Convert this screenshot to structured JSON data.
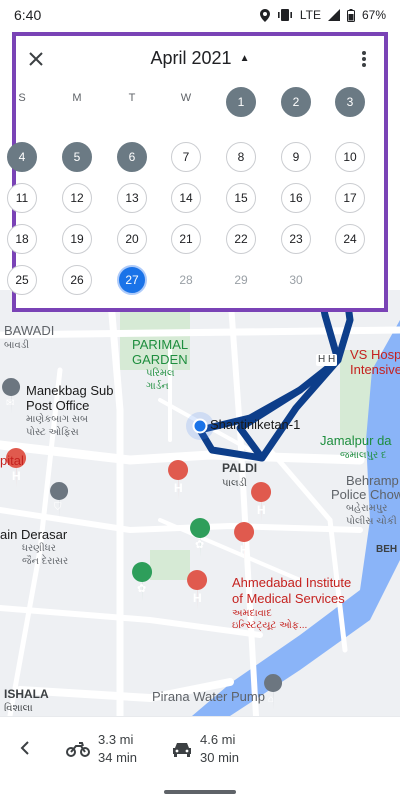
{
  "status_bar": {
    "time": "6:40",
    "network": "LTE",
    "battery": "67%",
    "icons": [
      "location-icon",
      "vibrate-icon",
      "signal-icon",
      "battery-icon"
    ]
  },
  "calendar": {
    "month_title": "April 2021",
    "caret": "▲",
    "close_icon": "close-icon",
    "more_icon": "more-vert-icon",
    "weekdays": [
      "S",
      "M",
      "T",
      "W",
      "T",
      "F",
      "S"
    ],
    "first_weekday_index": 4,
    "days_in_month": 30,
    "selected_day": 27,
    "days_with_history": [
      1,
      2,
      3,
      4,
      5,
      6
    ],
    "colors": {
      "border": "#7a43b6",
      "history": "#6b7a84",
      "selected": "#1a73e8"
    }
  },
  "map": {
    "labels": {
      "bawadi": "BAWADI",
      "bawadi_local": "બાવડી",
      "parimal_1": "PARIMAL",
      "parimal_2": "GARDEN",
      "parimal_local_1": "પરિમલ",
      "parimal_local_2": "ગાર્ડન",
      "vs_hosp_1": "VS Hosp",
      "vs_hosp_2": "Intensive",
      "manekbag_1": "Manekbag Sub",
      "manekbag_2": "Post Office",
      "manekbag_local_1": "માણેકબાગ સબ",
      "manekbag_local_2": "પોસ્ટ ઓફિસ",
      "shantiniketan": "Shantiniketan-1",
      "jamalpur": "Jamalpur da",
      "jamalpur_local": "જમાલપુર દ",
      "pital": "pital",
      "paldi": "PALDI",
      "paldi_local": "પાલડી",
      "behramp_1": "Behramp",
      "behramp_2": "Police Chow",
      "behramp_local_1": "બહેરામપુર",
      "behramp_local_2": "પોલીસ ચોકી",
      "derasar_1": "ain Derasar",
      "derasar_local_1": "ધરણીધર",
      "derasar_local_2": "જૈન દેરાસર",
      "ahmedabad_1": "Ahmedabad Institute",
      "ahmedabad_2": "of Medical Services",
      "ahmedabad_local_1": "અમદાવાદ",
      "ahmedabad_local_2": "ઇન્સ્ટિટ્યૂટ ઓફ...",
      "behe": "BEH",
      "ishala": "ISHALA",
      "ishala_local": "વિશાલા",
      "pirana": "Pirana Water Pump",
      "hh": "H H"
    },
    "colors": {
      "route": "#0d3e8a",
      "river": "#8ab4f8",
      "hospital": "#e05a4e",
      "park_pin": "#2e9e5b"
    }
  },
  "bottom_bar": {
    "back_icon": "chevron-left-icon",
    "modes": [
      {
        "icon": "motorcycle-icon",
        "distance": "3.3 mi",
        "duration": "34 min"
      },
      {
        "icon": "car-icon",
        "distance": "4.6 mi",
        "duration": "30 min"
      }
    ]
  }
}
